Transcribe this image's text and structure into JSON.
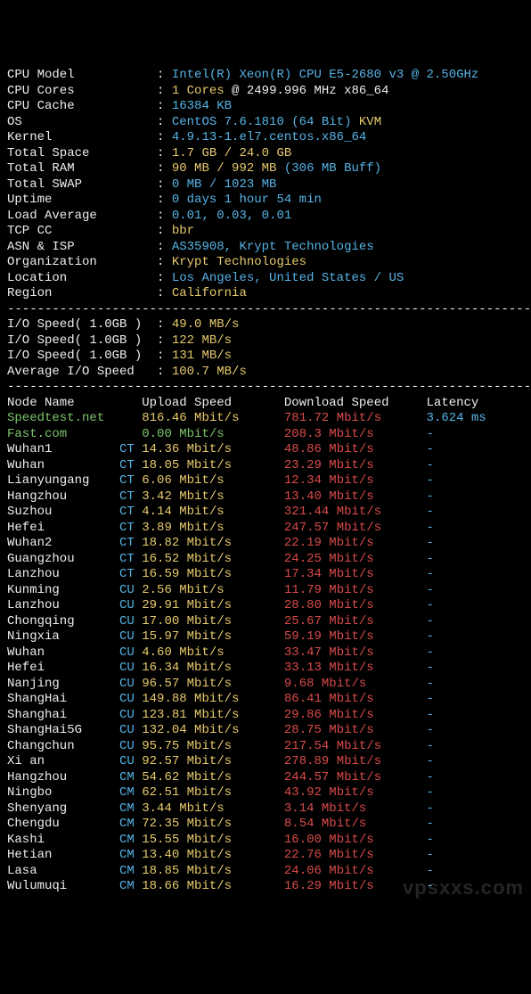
{
  "sysinfo": [
    {
      "label": "CPU Model",
      "sep": ":",
      "segs": [
        {
          "t": "Intel(R) Xeon(R) CPU E5-2680 v3 @ 2.50GHz",
          "c": "cyan"
        }
      ]
    },
    {
      "label": "CPU Cores",
      "sep": ":",
      "segs": [
        {
          "t": "1 Cores",
          "c": "yellow"
        },
        {
          "t": " @ 2499.996 MHz x86_64",
          "c": "white"
        }
      ]
    },
    {
      "label": "CPU Cache",
      "sep": ":",
      "segs": [
        {
          "t": "16384 KB",
          "c": "cyan"
        }
      ]
    },
    {
      "label": "OS",
      "sep": ":",
      "segs": [
        {
          "t": "CentOS 7.6.1810 (64 Bit) ",
          "c": "cyan"
        },
        {
          "t": "KVM",
          "c": "yellow"
        }
      ]
    },
    {
      "label": "Kernel",
      "sep": ":",
      "segs": [
        {
          "t": "4.9.13-1.el7.centos.x86_64",
          "c": "cyan"
        }
      ]
    },
    {
      "label": "Total Space",
      "sep": ":",
      "segs": [
        {
          "t": "1.7 GB / 24.0 GB",
          "c": "yellow"
        }
      ]
    },
    {
      "label": "Total RAM",
      "sep": ":",
      "segs": [
        {
          "t": "90 MB / 992 MB",
          "c": "yellow"
        },
        {
          "t": " (306 MB Buff)",
          "c": "cyan"
        }
      ]
    },
    {
      "label": "Total SWAP",
      "sep": ":",
      "segs": [
        {
          "t": "0 MB / 1023 MB",
          "c": "cyan"
        }
      ]
    },
    {
      "label": "Uptime",
      "sep": ":",
      "segs": [
        {
          "t": "0 days 1 hour 54 min",
          "c": "cyan"
        }
      ]
    },
    {
      "label": "Load Average",
      "sep": ":",
      "segs": [
        {
          "t": "0.01, 0.03, 0.01",
          "c": "cyan"
        }
      ]
    },
    {
      "label": "TCP CC",
      "sep": ":",
      "segs": [
        {
          "t": "bbr",
          "c": "yellow"
        }
      ]
    },
    {
      "label": "ASN & ISP",
      "sep": ":",
      "segs": [
        {
          "t": "AS35908, Krypt Technologies",
          "c": "cyan"
        }
      ]
    },
    {
      "label": "Organization",
      "sep": ":",
      "segs": [
        {
          "t": "Krypt Technologies",
          "c": "yellow"
        }
      ]
    },
    {
      "label": "Location",
      "sep": ":",
      "segs": [
        {
          "t": "Los Angeles, United States / US",
          "c": "cyan"
        }
      ]
    },
    {
      "label": "Region",
      "sep": ":",
      "segs": [
        {
          "t": "California",
          "c": "yellow"
        }
      ]
    }
  ],
  "io": [
    {
      "label": "I/O Speed( 1.0GB )",
      "val": "49.0 MB/s"
    },
    {
      "label": "I/O Speed( 1.0GB )",
      "val": "122 MB/s"
    },
    {
      "label": "I/O Speed( 1.0GB )",
      "val": "131 MB/s"
    },
    {
      "label": "Average I/O Speed",
      "val": "100.7 MB/s"
    }
  ],
  "st_header": {
    "c0": "Node Name",
    "c1": "Upload Speed",
    "c2": "Download Speed",
    "c3": "Latency"
  },
  "st": [
    {
      "name": "Speedtest.net",
      "nc": "green",
      "isp": "",
      "up": "816.46 Mbit/s",
      "dn": "781.72 Mbit/s",
      "lat": "3.624 ms"
    },
    {
      "name": "Fast.com",
      "nc": "green",
      "isp": "",
      "up": "0.00 Mbit/s",
      "upc": "green",
      "dn": "208.3 Mbit/s",
      "lat": "-"
    },
    {
      "name": "Wuhan1",
      "nc": "white",
      "isp": "CT",
      "up": "14.36 Mbit/s",
      "dn": "48.86 Mbit/s",
      "lat": "-"
    },
    {
      "name": "Wuhan",
      "nc": "white",
      "isp": "CT",
      "up": "18.05 Mbit/s",
      "dn": "23.29 Mbit/s",
      "lat": "-"
    },
    {
      "name": "Lianyungang",
      "nc": "white",
      "isp": "CT",
      "up": "6.06 Mbit/s",
      "dn": "12.34 Mbit/s",
      "lat": "-"
    },
    {
      "name": "Hangzhou",
      "nc": "white",
      "isp": "CT",
      "up": "3.42 Mbit/s",
      "dn": "13.40 Mbit/s",
      "lat": "-"
    },
    {
      "name": "Suzhou",
      "nc": "white",
      "isp": "CT",
      "up": "4.14 Mbit/s",
      "dn": "321.44 Mbit/s",
      "lat": "-"
    },
    {
      "name": "Hefei",
      "nc": "white",
      "isp": "CT",
      "up": "3.89 Mbit/s",
      "dn": "247.57 Mbit/s",
      "lat": "-"
    },
    {
      "name": "Wuhan2",
      "nc": "white",
      "isp": "CT",
      "up": "18.82 Mbit/s",
      "dn": "22.19 Mbit/s",
      "lat": "-"
    },
    {
      "name": "Guangzhou",
      "nc": "white",
      "isp": "CT",
      "up": "16.52 Mbit/s",
      "dn": "24.25 Mbit/s",
      "lat": "-"
    },
    {
      "name": "Lanzhou",
      "nc": "white",
      "isp": "CT",
      "up": "16.59 Mbit/s",
      "dn": "17.34 Mbit/s",
      "lat": "-"
    },
    {
      "name": "Kunming",
      "nc": "white",
      "isp": "CU",
      "up": "2.56 Mbit/s",
      "dn": "11.79 Mbit/s",
      "lat": "-"
    },
    {
      "name": "Lanzhou",
      "nc": "white",
      "isp": "CU",
      "up": "29.91 Mbit/s",
      "dn": "28.80 Mbit/s",
      "lat": "-"
    },
    {
      "name": "Chongqing",
      "nc": "white",
      "isp": "CU",
      "up": "17.00 Mbit/s",
      "dn": "25.67 Mbit/s",
      "lat": "-"
    },
    {
      "name": "Ningxia",
      "nc": "white",
      "isp": "CU",
      "up": "15.97 Mbit/s",
      "dn": "59.19 Mbit/s",
      "lat": "-"
    },
    {
      "name": "Wuhan",
      "nc": "white",
      "isp": "CU",
      "up": "4.60 Mbit/s",
      "dn": "33.47 Mbit/s",
      "lat": "-"
    },
    {
      "name": "Hefei",
      "nc": "white",
      "isp": "CU",
      "up": "16.34 Mbit/s",
      "dn": "33.13 Mbit/s",
      "lat": "-"
    },
    {
      "name": "Nanjing",
      "nc": "white",
      "isp": "CU",
      "up": "96.57 Mbit/s",
      "dn": "9.68 Mbit/s",
      "lat": "-"
    },
    {
      "name": "ShangHai",
      "nc": "white",
      "isp": "CU",
      "up": "149.88 Mbit/s",
      "dn": "86.41 Mbit/s",
      "lat": "-"
    },
    {
      "name": "Shanghai",
      "nc": "white",
      "isp": "CU",
      "up": "123.81 Mbit/s",
      "dn": "29.86 Mbit/s",
      "lat": "-"
    },
    {
      "name": "ShangHai5G",
      "nc": "white",
      "isp": "CU",
      "up": "132.04 Mbit/s",
      "dn": "28.75 Mbit/s",
      "lat": "-"
    },
    {
      "name": "Changchun",
      "nc": "white",
      "isp": "CU",
      "up": "95.75 Mbit/s",
      "dn": "217.54 Mbit/s",
      "lat": "-"
    },
    {
      "name": "Xi an",
      "nc": "white",
      "isp": "CU",
      "up": "92.57 Mbit/s",
      "dn": "278.89 Mbit/s",
      "lat": "-"
    },
    {
      "name": "Hangzhou",
      "nc": "white",
      "isp": "CM",
      "up": "54.62 Mbit/s",
      "dn": "244.57 Mbit/s",
      "lat": "-"
    },
    {
      "name": "Ningbo",
      "nc": "white",
      "isp": "CM",
      "up": "62.51 Mbit/s",
      "dn": "43.92 Mbit/s",
      "lat": "-"
    },
    {
      "name": "Shenyang",
      "nc": "white",
      "isp": "CM",
      "up": "3.44 Mbit/s",
      "dn": "3.14 Mbit/s",
      "lat": "-"
    },
    {
      "name": "Chengdu",
      "nc": "white",
      "isp": "CM",
      "up": "72.35 Mbit/s",
      "dn": "8.54 Mbit/s",
      "lat": "-"
    },
    {
      "name": "Kashi",
      "nc": "white",
      "isp": "CM",
      "up": "15.55 Mbit/s",
      "dn": "16.00 Mbit/s",
      "lat": "-"
    },
    {
      "name": "Hetian",
      "nc": "white",
      "isp": "CM",
      "up": "13.40 Mbit/s",
      "dn": "22.76 Mbit/s",
      "lat": "-"
    },
    {
      "name": "Lasa",
      "nc": "white",
      "isp": "CM",
      "up": "18.85 Mbit/s",
      "dn": "24.06 Mbit/s",
      "lat": "-"
    },
    {
      "name": "Wulumuqi",
      "nc": "white",
      "isp": "CM",
      "up": "18.66 Mbit/s",
      "dn": "16.29 Mbit/s",
      "lat": "-"
    }
  ],
  "dashes": "----------------------------------------------------------------------",
  "watermark": "vpsxxs.com"
}
